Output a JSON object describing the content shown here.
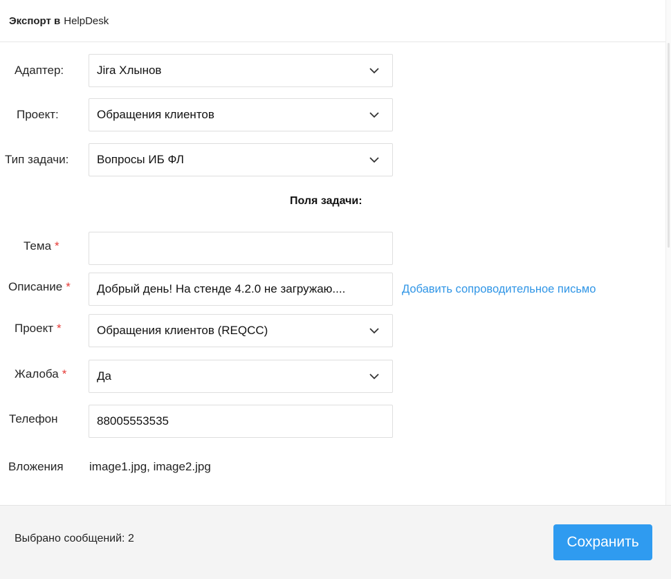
{
  "header": {
    "title_bold": "Экспорт в",
    "title_rest": "HelpDesk"
  },
  "form": {
    "adapter": {
      "label": "Адаптер:",
      "value": "Jira Хлынов"
    },
    "project": {
      "label": "Проект:",
      "value": "Обращения клиентов"
    },
    "task_type": {
      "label": "Тип задачи:",
      "value": "Вопросы ИБ ФЛ"
    }
  },
  "fields": {
    "section_title": "Поля задачи:",
    "required_mark": "*",
    "subject": {
      "label": "Тема",
      "value": ""
    },
    "description": {
      "label": "Описание",
      "value": "Добрый день! На стенде 4.2.0 не загружаю....",
      "link": "Добавить сопроводительное письмо"
    },
    "project": {
      "label": "Проект",
      "value": "Обращения клиентов (REQCC)"
    },
    "complaint": {
      "label": "Жалоба",
      "value": "Да"
    },
    "phone": {
      "label": "Телефон",
      "value": "88005553535"
    },
    "attachments": {
      "label": "Вложения",
      "value": "image1.jpg, image2.jpg"
    }
  },
  "footer": {
    "selected_text": "Выбрано сообщений: 2",
    "save_label": "Сохранить"
  },
  "colors": {
    "accent": "#2f9bf0",
    "link": "#2f95e6",
    "required": "#e53935"
  },
  "icons": {
    "select_indicator": "chevron-down-icon"
  }
}
